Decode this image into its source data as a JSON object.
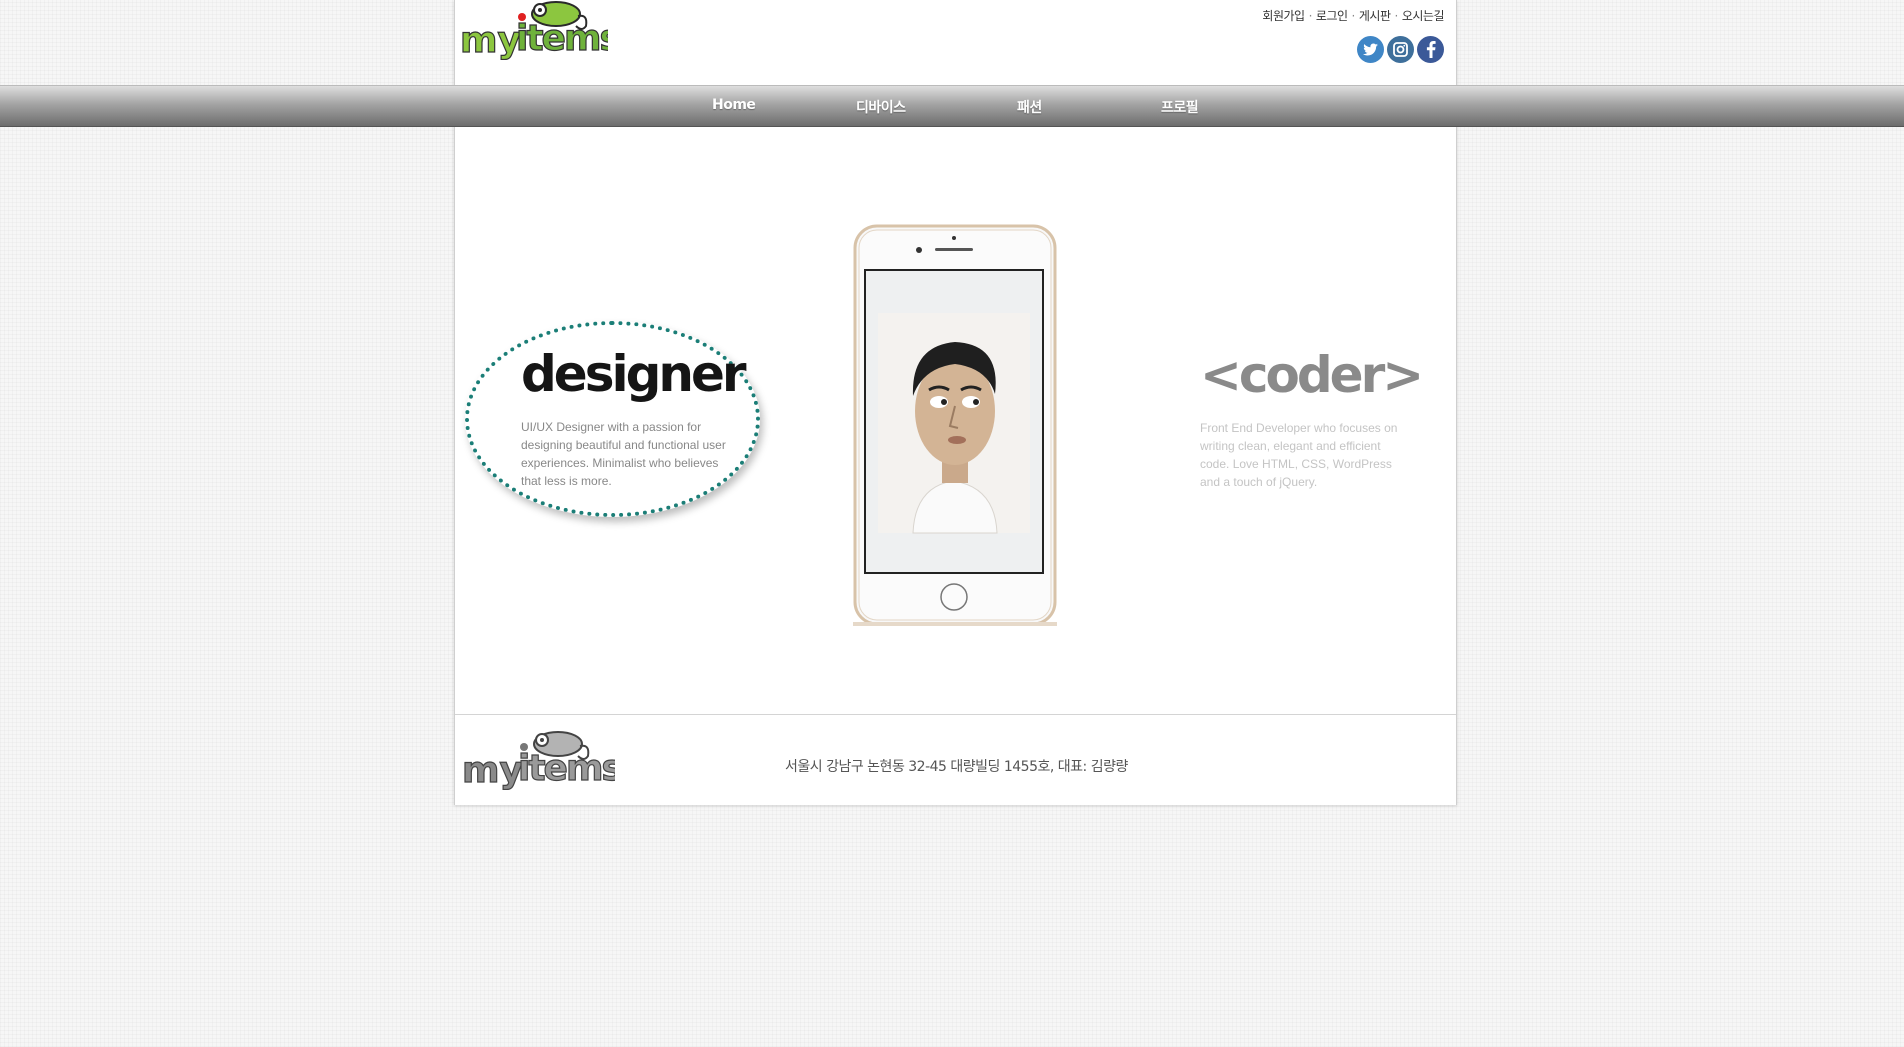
{
  "header": {
    "logo_text_my": "my",
    "logo_text_items": "items",
    "top_links": [
      "회원가입",
      "로그인",
      "게시판",
      "오시는길"
    ],
    "social": [
      {
        "name": "twitter",
        "glyph": "t",
        "color": "#3f86c6"
      },
      {
        "name": "instagram",
        "glyph": "◙",
        "color": "#3e6f9b"
      },
      {
        "name": "facebook",
        "glyph": "f",
        "color": "#3b5998"
      }
    ]
  },
  "nav": {
    "items": [
      "Home",
      "디바이스",
      "패션",
      "프로필"
    ]
  },
  "main": {
    "designer": {
      "title": "designer",
      "text": "UI/UX Designer with a passion for designing beautiful and functional user experiences. Minimalist who believes that less is more."
    },
    "coder": {
      "title": "<coder>",
      "text": "Front End Developer who focuses on writing clean, elegant and efficient code. Love HTML, CSS, WordPress and a touch of jQuery."
    }
  },
  "footer": {
    "logo_text_my": "my",
    "logo_text_items": "items",
    "address": "서울시 강남구 논현동 32-45 대량빌딩 1455호, 대표: 김량량"
  }
}
